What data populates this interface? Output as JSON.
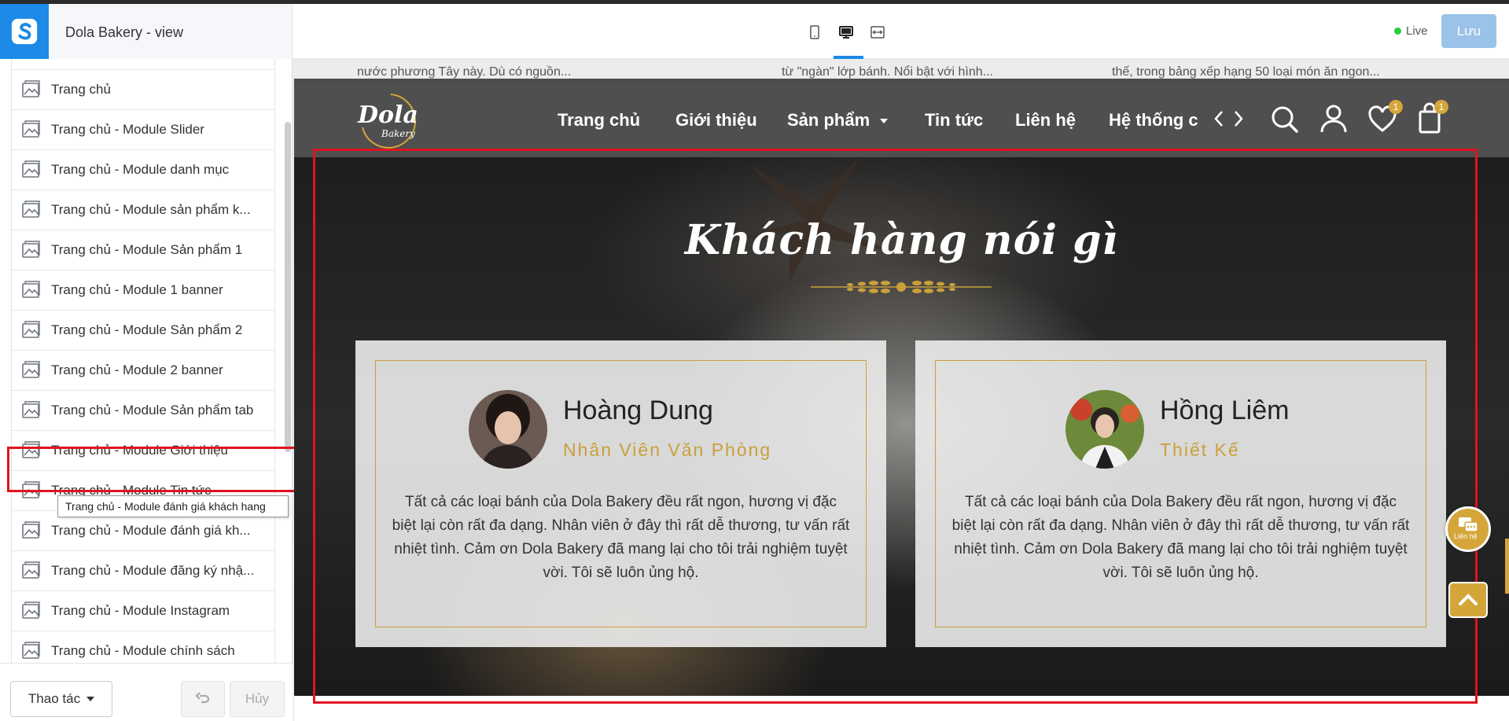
{
  "editor": {
    "title": "Dola Bakery - view",
    "live_label": "Live",
    "save_label": "Lưu"
  },
  "sidebar": {
    "items": [
      {
        "label": "Trang chủ"
      },
      {
        "label": "Trang chủ - Module Slider"
      },
      {
        "label": "Trang chủ - Module danh mục"
      },
      {
        "label": "Trang chủ - Module sản phẩm k..."
      },
      {
        "label": "Trang chủ - Module Sản phẩm 1"
      },
      {
        "label": "Trang chủ - Module 1 banner"
      },
      {
        "label": "Trang chủ - Module Sản phẩm 2"
      },
      {
        "label": "Trang chủ - Module 2 banner"
      },
      {
        "label": "Trang chủ - Module Sản phẩm tab"
      },
      {
        "label": "Trang chủ - Module Giới thiệu"
      },
      {
        "label": "Trang chủ - Module Tin tức"
      },
      {
        "label": "Trang chủ - Module đánh giá kh..."
      },
      {
        "label": "Trang chủ - Module đăng ký nhậ..."
      },
      {
        "label": "Trang chủ - Module Instagram"
      },
      {
        "label": "Trang chủ - Module chính sách"
      }
    ],
    "tooltip": "Trang chủ - Module đánh giá khách hang",
    "action_label": "Thao tác",
    "cancel_label": "Hủy"
  },
  "preview": {
    "top_snippets": [
      "nước phương Tây này. Dù có nguồn...",
      "từ \"ngàn\" lớp bánh. Nổi bật với hình...",
      "thế, trong bảng xếp hạng 50 loại món ăn ngon..."
    ],
    "nav": {
      "links": [
        "Trang chủ",
        "Giới thiệu",
        "Sản phẩm",
        "Tin tức",
        "Liên hệ",
        "Hệ thống c"
      ],
      "wishlist_count": "1",
      "cart_count": "1"
    },
    "testimonial": {
      "title": "Khách hàng nói gì",
      "cards": [
        {
          "name": "Hoàng Dung",
          "role": "Nhân Viên Văn Phòng",
          "quote": "Tất cả các loại bánh của Dola Bakery đều rất ngon, hương vị đặc biệt lại còn rất đa dạng. Nhân viên ở đây thì rất dễ thương, tư vấn rất nhiệt tình. Cảm ơn Dola Bakery đã mang lại cho tôi trải nghiệm tuyệt vời. Tôi sẽ luôn ủng hộ."
        },
        {
          "name": "Hồng Liêm",
          "role": "Thiết Kế",
          "quote": "Tất cả các loại bánh của Dola Bakery đều rất ngon, hương vị đặc biệt lại còn rất đa dạng. Nhân viên ở đây thì rất dễ thương, tư vấn rất nhiệt tình. Cảm ơn Dola Bakery đã mang lại cho tôi trải nghiệm tuyệt vời. Tôi sẽ luôn ủng hộ."
        }
      ]
    },
    "contact_label": "Liên hệ"
  },
  "colors": {
    "brand_blue": "#1c8ae6",
    "save_button": "#9bc3e9",
    "gold": "#c9a03b",
    "selection_red": "#e0131f"
  }
}
